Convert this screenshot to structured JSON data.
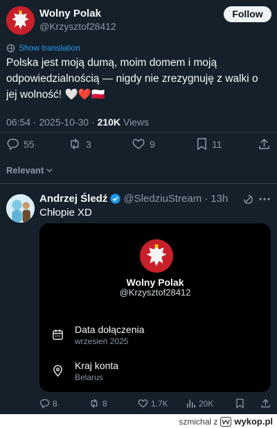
{
  "post": {
    "author_name": "Wolny Polak",
    "author_handle": "@Krzysztof28412",
    "follow_label": "Follow",
    "show_translation": "Show translation",
    "text": "Polska jest moją dumą, moim domem i moją odpowiedzialnością — nigdy nie zrezygnuję z walki o jej wolność!",
    "emoji": "🤍❤️🇵🇱",
    "timestamp": "06:54 · 2025-10-30 ·",
    "views_count": "210K",
    "views_label": "Views",
    "stats": {
      "replies": "55",
      "reposts": "3",
      "likes": "9",
      "bookmarks": "11"
    }
  },
  "sort": {
    "label": "Relevant"
  },
  "reply": {
    "author_name": "Andrzej Śledź",
    "author_handle": "@SledziuStream",
    "time": "· 13h",
    "text": "Chłopie XD",
    "card": {
      "name": "Wolny Polak",
      "handle": "@Krzysztof28412",
      "joined_label": "Data dołączenia",
      "joined_value": "wrzesień 2025",
      "country_label": "Kraj konta",
      "country_value": "Belarus"
    },
    "stats": {
      "replies": "8",
      "reposts": "8",
      "likes": "1.7K",
      "views": "20K"
    }
  },
  "watermark": {
    "user": "szmichal z",
    "site": "wykop.pl"
  },
  "colors": {
    "background": "#15202b",
    "accent": "#1d9bf0",
    "like_red": "#f91880",
    "verified": "#1d9bf0"
  },
  "icons": [
    "eagle-avatar-icon",
    "translate-icon",
    "reply-icon",
    "repost-icon",
    "like-icon",
    "bookmark-icon",
    "share-icon",
    "chevron-down-icon",
    "verified-badge-icon",
    "more-icon",
    "calendar-icon",
    "location-icon",
    "views-icon",
    "wykop-logo-icon"
  ]
}
